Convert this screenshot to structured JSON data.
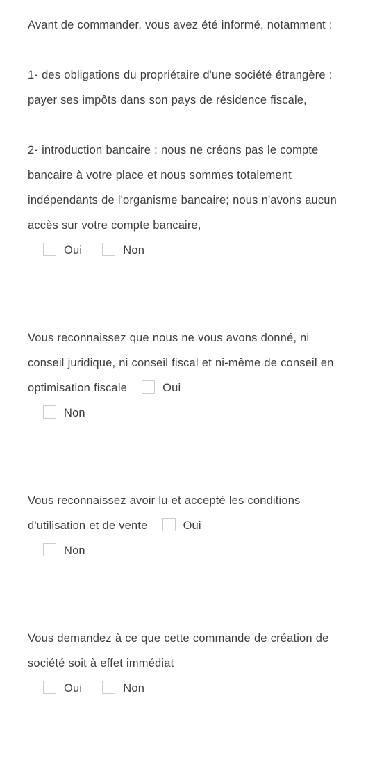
{
  "page": {
    "language": "fr",
    "background_color": "#ffffff",
    "text_color": "#3c4043",
    "checkbox_border_color": "#cdcdcd"
  },
  "intro": {
    "paragraph_1": "Avant de commander, vous avez été informé, notamment :",
    "paragraph_2": "1- des obligations du propriétaire d'une société étrangère : payer ses impôts dans son pays de résidence fiscale,",
    "paragraph_3": "2- introduction bancaire : nous ne créons pas le compte bancaire à votre place et nous sommes totalement indépendants de l'organisme bancaire; nous n'avons aucun accès sur votre compte bancaire,"
  },
  "options": {
    "yes": "Oui",
    "no": "Non"
  },
  "questions": [
    {
      "id": "q1-informations-prealables",
      "prompt": "",
      "layout": "options-below",
      "yes_label": "Oui",
      "no_label": "Non",
      "yes_checked": false,
      "no_checked": false
    },
    {
      "id": "q2-aucun-conseil",
      "prompt": "Vous reconnaissez que nous ne vous avons donné, ni conseil juridique, ni conseil fiscal et ni-même de conseil en optimisation fiscale",
      "layout": "options-inline",
      "yes_label": "Oui",
      "no_label": "Non",
      "yes_checked": false,
      "no_checked": false
    },
    {
      "id": "q3-conditions-utilisation-vente",
      "prompt": "Vous reconnaissez avoir lu et accepté les conditions d'utilisation et de vente",
      "layout": "options-inline",
      "yes_label": "Oui",
      "no_label": "Non",
      "yes_checked": false,
      "no_checked": false
    },
    {
      "id": "q4-effet-immediat",
      "prompt": "Vous demandez à ce que cette commande de création de société soit à effet immédiat",
      "layout": "options-below",
      "yes_label": "Oui",
      "no_label": "Non",
      "yes_checked": false,
      "no_checked": false
    }
  ]
}
